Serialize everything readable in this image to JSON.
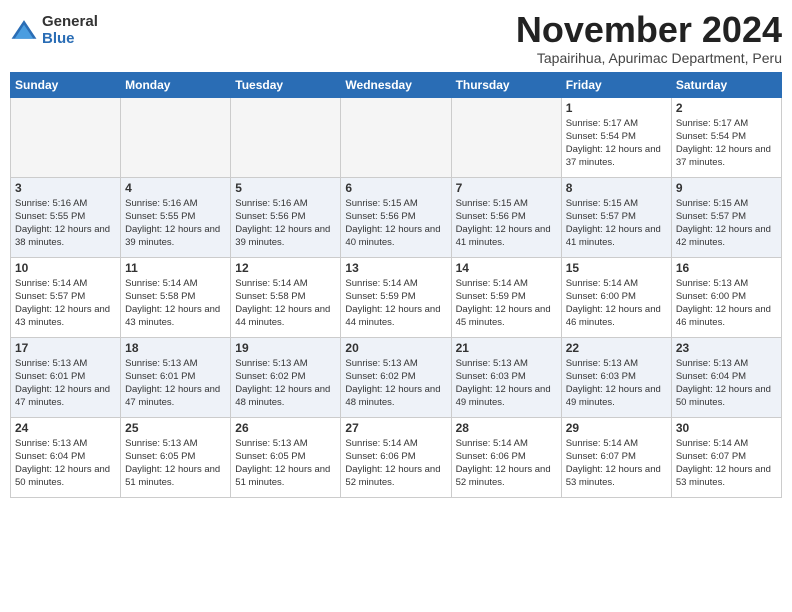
{
  "header": {
    "logo_general": "General",
    "logo_blue": "Blue",
    "month_title": "November 2024",
    "subtitle": "Tapairihua, Apurimac Department, Peru"
  },
  "days_of_week": [
    "Sunday",
    "Monday",
    "Tuesday",
    "Wednesday",
    "Thursday",
    "Friday",
    "Saturday"
  ],
  "weeks": [
    [
      {
        "day": "",
        "empty": true
      },
      {
        "day": "",
        "empty": true
      },
      {
        "day": "",
        "empty": true
      },
      {
        "day": "",
        "empty": true
      },
      {
        "day": "",
        "empty": true
      },
      {
        "day": "1",
        "sunrise": "5:17 AM",
        "sunset": "5:54 PM",
        "daylight": "12 hours and 37 minutes."
      },
      {
        "day": "2",
        "sunrise": "5:17 AM",
        "sunset": "5:54 PM",
        "daylight": "12 hours and 37 minutes."
      }
    ],
    [
      {
        "day": "3",
        "sunrise": "5:16 AM",
        "sunset": "5:55 PM",
        "daylight": "12 hours and 38 minutes."
      },
      {
        "day": "4",
        "sunrise": "5:16 AM",
        "sunset": "5:55 PM",
        "daylight": "12 hours and 39 minutes."
      },
      {
        "day": "5",
        "sunrise": "5:16 AM",
        "sunset": "5:56 PM",
        "daylight": "12 hours and 39 minutes."
      },
      {
        "day": "6",
        "sunrise": "5:15 AM",
        "sunset": "5:56 PM",
        "daylight": "12 hours and 40 minutes."
      },
      {
        "day": "7",
        "sunrise": "5:15 AM",
        "sunset": "5:56 PM",
        "daylight": "12 hours and 41 minutes."
      },
      {
        "day": "8",
        "sunrise": "5:15 AM",
        "sunset": "5:57 PM",
        "daylight": "12 hours and 41 minutes."
      },
      {
        "day": "9",
        "sunrise": "5:15 AM",
        "sunset": "5:57 PM",
        "daylight": "12 hours and 42 minutes."
      }
    ],
    [
      {
        "day": "10",
        "sunrise": "5:14 AM",
        "sunset": "5:57 PM",
        "daylight": "12 hours and 43 minutes."
      },
      {
        "day": "11",
        "sunrise": "5:14 AM",
        "sunset": "5:58 PM",
        "daylight": "12 hours and 43 minutes."
      },
      {
        "day": "12",
        "sunrise": "5:14 AM",
        "sunset": "5:58 PM",
        "daylight": "12 hours and 44 minutes."
      },
      {
        "day": "13",
        "sunrise": "5:14 AM",
        "sunset": "5:59 PM",
        "daylight": "12 hours and 44 minutes."
      },
      {
        "day": "14",
        "sunrise": "5:14 AM",
        "sunset": "5:59 PM",
        "daylight": "12 hours and 45 minutes."
      },
      {
        "day": "15",
        "sunrise": "5:14 AM",
        "sunset": "6:00 PM",
        "daylight": "12 hours and 46 minutes."
      },
      {
        "day": "16",
        "sunrise": "5:13 AM",
        "sunset": "6:00 PM",
        "daylight": "12 hours and 46 minutes."
      }
    ],
    [
      {
        "day": "17",
        "sunrise": "5:13 AM",
        "sunset": "6:01 PM",
        "daylight": "12 hours and 47 minutes."
      },
      {
        "day": "18",
        "sunrise": "5:13 AM",
        "sunset": "6:01 PM",
        "daylight": "12 hours and 47 minutes."
      },
      {
        "day": "19",
        "sunrise": "5:13 AM",
        "sunset": "6:02 PM",
        "daylight": "12 hours and 48 minutes."
      },
      {
        "day": "20",
        "sunrise": "5:13 AM",
        "sunset": "6:02 PM",
        "daylight": "12 hours and 48 minutes."
      },
      {
        "day": "21",
        "sunrise": "5:13 AM",
        "sunset": "6:03 PM",
        "daylight": "12 hours and 49 minutes."
      },
      {
        "day": "22",
        "sunrise": "5:13 AM",
        "sunset": "6:03 PM",
        "daylight": "12 hours and 49 minutes."
      },
      {
        "day": "23",
        "sunrise": "5:13 AM",
        "sunset": "6:04 PM",
        "daylight": "12 hours and 50 minutes."
      }
    ],
    [
      {
        "day": "24",
        "sunrise": "5:13 AM",
        "sunset": "6:04 PM",
        "daylight": "12 hours and 50 minutes."
      },
      {
        "day": "25",
        "sunrise": "5:13 AM",
        "sunset": "6:05 PM",
        "daylight": "12 hours and 51 minutes."
      },
      {
        "day": "26",
        "sunrise": "5:13 AM",
        "sunset": "6:05 PM",
        "daylight": "12 hours and 51 minutes."
      },
      {
        "day": "27",
        "sunrise": "5:14 AM",
        "sunset": "6:06 PM",
        "daylight": "12 hours and 52 minutes."
      },
      {
        "day": "28",
        "sunrise": "5:14 AM",
        "sunset": "6:06 PM",
        "daylight": "12 hours and 52 minutes."
      },
      {
        "day": "29",
        "sunrise": "5:14 AM",
        "sunset": "6:07 PM",
        "daylight": "12 hours and 53 minutes."
      },
      {
        "day": "30",
        "sunrise": "5:14 AM",
        "sunset": "6:07 PM",
        "daylight": "12 hours and 53 minutes."
      }
    ]
  ]
}
